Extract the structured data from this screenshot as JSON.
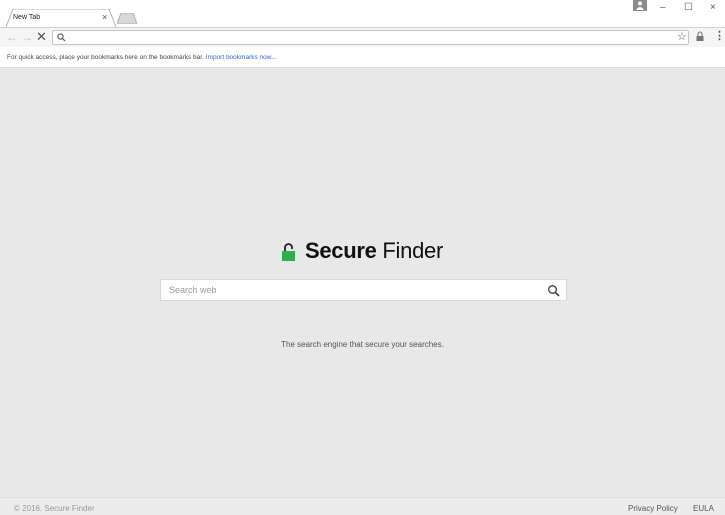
{
  "tab": {
    "title": "New Tab",
    "close": "×"
  },
  "window_controls": {
    "minimize": "–",
    "maximize": "☐",
    "close": "×"
  },
  "toolbar": {
    "back": "←",
    "forward": "→",
    "stop": "✕",
    "address_value": "",
    "star": "☆",
    "menu": "⋮"
  },
  "bookmarks_bar": {
    "text": "For quick access, place your bookmarks here on the bookmarks bar.",
    "import_link": "Import bookmarks now..."
  },
  "logo": {
    "bold": "Secure",
    "regular": "Finder",
    "lock_color": "#2fb04a"
  },
  "search": {
    "placeholder": "Search web",
    "value": ""
  },
  "tagline": "The search engine that secure your searches.",
  "footer": {
    "copyright": "© 2016. Secure Finder",
    "links": [
      "Privacy Policy",
      "EULA"
    ]
  },
  "icons": [
    "search-icon",
    "star-icon",
    "lock-icon",
    "menu-icon",
    "profile-icon",
    "close-icon"
  ]
}
